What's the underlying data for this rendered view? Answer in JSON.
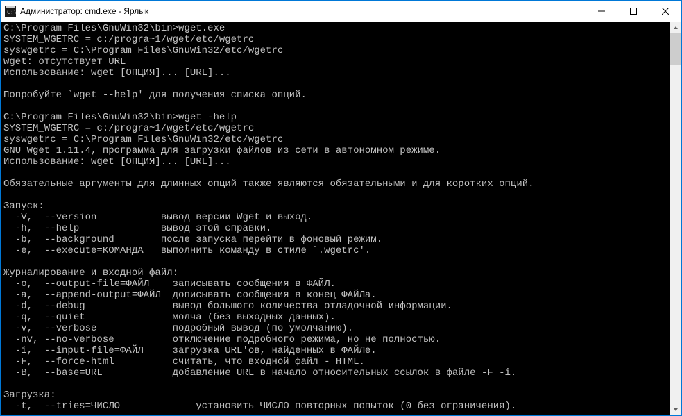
{
  "window": {
    "title": "Администратор: cmd.exe - Ярлык"
  },
  "terminal": {
    "lines": [
      "C:\\Program Files\\GnuWin32\\bin>wget.exe",
      "SYSTEM_WGETRC = c:/progra~1/wget/etc/wgetrc",
      "syswgetrc = C:\\Program Files\\GnuWin32/etc/wgetrc",
      "wget: отсутствует URL",
      "Использование: wget [ОПЦИЯ]... [URL]...",
      "",
      "Попробуйте `wget --help' для получения списка опций.",
      "",
      "C:\\Program Files\\GnuWin32\\bin>wget -help",
      "SYSTEM_WGETRC = c:/progra~1/wget/etc/wgetrc",
      "syswgetrc = C:\\Program Files\\GnuWin32/etc/wgetrc",
      "GNU Wget 1.11.4, программа для загрузки файлов из сети в автономном режиме.",
      "Использование: wget [ОПЦИЯ]... [URL]...",
      "",
      "Обязательные аргументы для длинных опций также являются обязательными и для коротких опций.",
      "",
      "Запуск:",
      "  -V,  --version           вывод версии Wget и выход.",
      "  -h,  --help              вывод этой справки.",
      "  -b,  --background        после запуска перейти в фоновый режим.",
      "  -e,  --execute=КОМАНДА   выполнить команду в стиле `.wgetrc'.",
      "",
      "Журналирование и входной файл:",
      "  -o,  --output-file=ФАЙЛ    записывать сообщения в ФАЙЛ.",
      "  -a,  --append-output=ФАЙЛ  дописывать сообщения в конец ФАЙЛа.",
      "  -d,  --debug               вывод большого количества отладочной информации.",
      "  -q,  --quiet               молча (без выходных данных).",
      "  -v,  --verbose             подробный вывод (по умолчанию).",
      "  -nv, --no-verbose          отключение подробного режима, но не полностью.",
      "  -i,  --input-file=ФАЙЛ     загрузка URL'ов, найденных в ФАЙЛе.",
      "  -F,  --force-html          считать, что входной файл - HTML.",
      "  -B,  --base=URL            добавление URL в начало относительных ссылок в файле -F -i.",
      "",
      "Загрузка:",
      "  -t,  --tries=ЧИСЛО             установить ЧИСЛО повторных попыток (0 без ограничения)."
    ]
  }
}
